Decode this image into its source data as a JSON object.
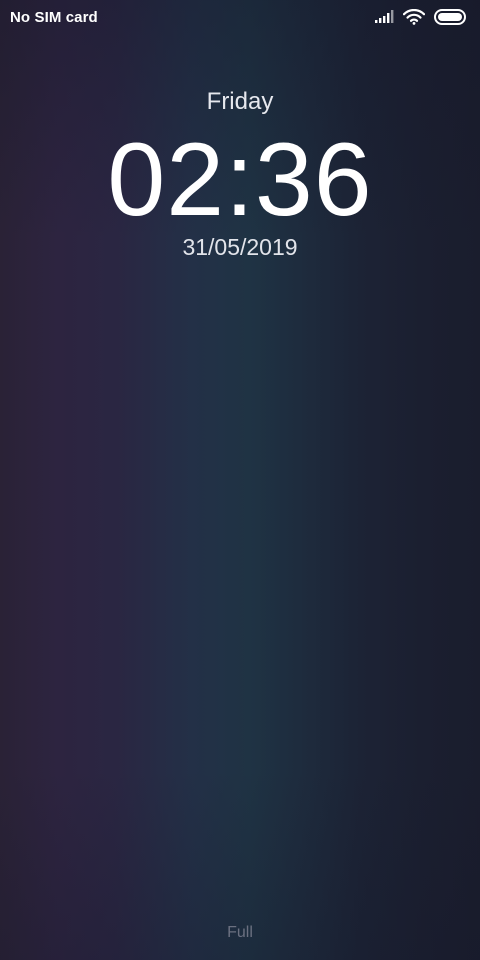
{
  "status_bar": {
    "carrier": "No SIM card",
    "icons": [
      "signal-icon",
      "wifi-icon",
      "battery-icon"
    ]
  },
  "lock": {
    "day": "Friday",
    "time": "02:36",
    "date": "31/05/2019"
  },
  "bottom": {
    "battery_status": "Full"
  },
  "colors": {
    "background_left": "#2a2236",
    "background_center": "#1f3344",
    "background_right": "#1a1d2d",
    "text_primary": "#ffffff",
    "text_muted": "#6b7080"
  }
}
